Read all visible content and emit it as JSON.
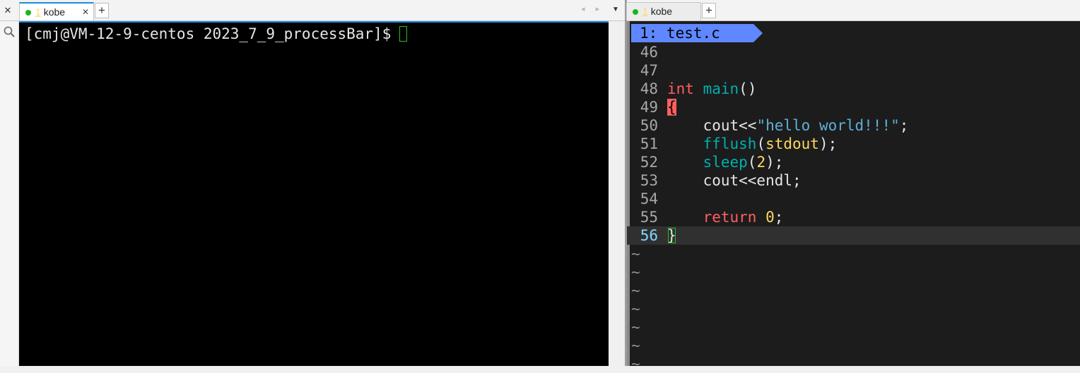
{
  "left": {
    "close_label": "✕",
    "tab": {
      "num": "1",
      "title": "kobe",
      "close": "✕"
    },
    "plus": "+",
    "nav_arrows": "◂ ▸",
    "dropdown": "▼",
    "terminal": {
      "prompt": "[cmj@VM-12-9-centos 2023_7_9_processBar]$"
    }
  },
  "right": {
    "tab": {
      "num": "1",
      "title": "kobe"
    },
    "plus": "+",
    "vim": {
      "tabline": "1: test.c",
      "lines": [
        {
          "num": "46"
        },
        {
          "num": "47"
        },
        {
          "num": "48",
          "parts": [
            [
              "int",
              "kw"
            ],
            [
              " "
            ],
            [
              "main",
              "fn"
            ],
            [
              "()"
            ]
          ]
        },
        {
          "num": "49",
          "parts": [
            [
              "{",
              "brace-open"
            ]
          ]
        },
        {
          "num": "50",
          "parts": [
            [
              "    cout<<"
            ],
            [
              "\"hello world!!!\"",
              "str"
            ],
            [
              ";"
            ]
          ]
        },
        {
          "num": "51",
          "parts": [
            [
              "    "
            ],
            [
              "fflush",
              "fn"
            ],
            [
              "("
            ],
            [
              "stdout",
              "par"
            ],
            [
              ");"
            ]
          ]
        },
        {
          "num": "52",
          "parts": [
            [
              "    "
            ],
            [
              "sleep",
              "fn"
            ],
            [
              "("
            ],
            [
              "2",
              "num"
            ],
            [
              ");"
            ]
          ]
        },
        {
          "num": "53",
          "parts": [
            [
              "    cout<<endl;"
            ]
          ]
        },
        {
          "num": "54"
        },
        {
          "num": "55",
          "parts": [
            [
              "    "
            ],
            [
              "return",
              "kw"
            ],
            [
              " "
            ],
            [
              "0",
              "num"
            ],
            [
              ";"
            ]
          ]
        },
        {
          "num": "56",
          "parts": [
            [
              "}",
              "brace-cur"
            ]
          ],
          "current": true
        }
      ],
      "tilde": "~",
      "tilde_count": 7
    }
  }
}
